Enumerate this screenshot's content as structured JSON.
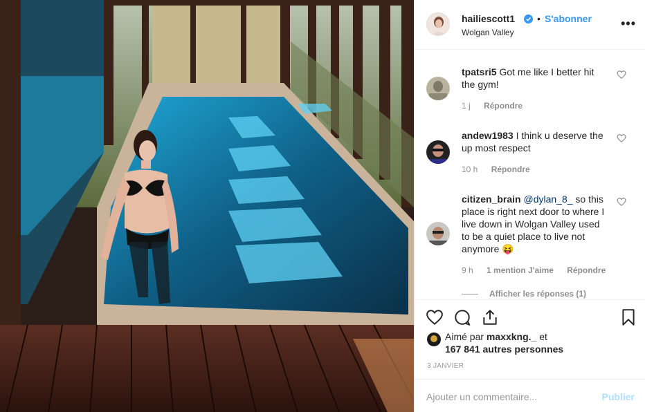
{
  "post": {
    "photo_alt": "",
    "username": "hailiescott1",
    "separator": "•",
    "follow_label": "S'abonner",
    "location": "Wolgan Valley",
    "more_label": "•••"
  },
  "comments": [
    {
      "username": "tpatsri5",
      "text": "Got me like I better hit the gym!",
      "time": "1 j",
      "likes": "",
      "reply_label": "Répondre"
    },
    {
      "username": "andew1983",
      "text": "I think u deserve the up most respect",
      "time": "10 h",
      "likes": "",
      "reply_label": "Répondre"
    },
    {
      "username": "citizen_brain",
      "mention": "@dylan_8_",
      "text": "so this place is right next door to where I live down in Wolgan Valley used to be a quiet place to live not anymore",
      "emoji": "😝",
      "time": "9 h",
      "likes": "1 mention J'aime",
      "reply_label": "Répondre"
    }
  ],
  "view_replies_label": "Afficher les réponses (1)",
  "liked_by": {
    "prefix": "Aimé par",
    "user": "maxxkng._",
    "connector": "et",
    "count_text": "167 841 autres personnes"
  },
  "date": "3 JANVIER",
  "add_comment": {
    "placeholder": "Ajouter un commentaire...",
    "post_label": "Publier"
  },
  "colors": {
    "accent": "#3897f0",
    "post_disabled": "#b2dffc",
    "muted": "#8e8e8e",
    "pool": "#1a9ac8"
  },
  "icons": [
    "heart-icon",
    "comment-icon",
    "share-icon",
    "bookmark-icon",
    "verified-icon",
    "more-icon"
  ]
}
